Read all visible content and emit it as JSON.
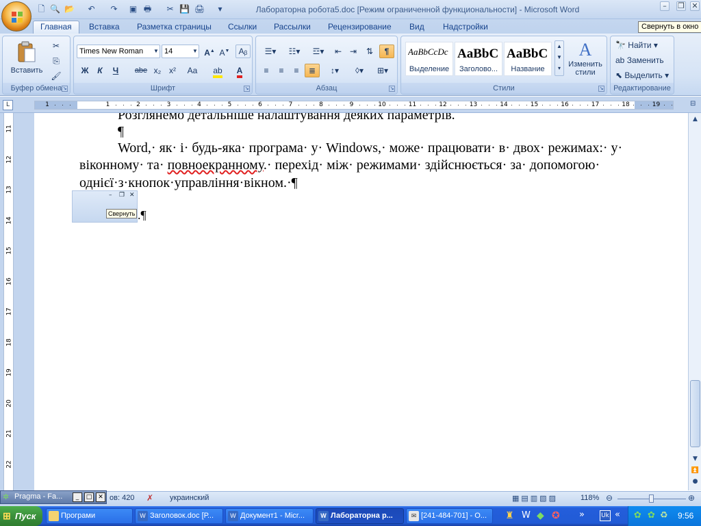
{
  "window": {
    "title": "Лабораторна робота5.doc [Режим ограниченной функциональности] - Microsoft Word",
    "tooltip": "Свернуть в окно"
  },
  "tabs": [
    "Главная",
    "Вставка",
    "Разметка страницы",
    "Ссылки",
    "Рассылки",
    "Рецензирование",
    "Вид",
    "Надстройки"
  ],
  "ribbon": {
    "clipboard": {
      "label": "Буфер обмена",
      "paste": "Вставить"
    },
    "font": {
      "label": "Шрифт",
      "name": "Times New Roman",
      "size": "14",
      "bold": "Ж",
      "italic": "К",
      "underline": "Ч",
      "strike": "abe",
      "sub": "x₂",
      "sup": "x²",
      "case": "Aa"
    },
    "paragraph": {
      "label": "Абзац"
    },
    "styles": {
      "label": "Стили",
      "items": [
        {
          "sample": "AaBbCcDc",
          "name": "Выделение"
        },
        {
          "sample": "AaBbC",
          "name": "Заголово..."
        },
        {
          "sample": "AaBbC",
          "name": "Название"
        }
      ],
      "change": "Изменить стили"
    },
    "editing": {
      "label": "Редактирование",
      "find": "Найти",
      "replace": "Заменить",
      "select": "Выделить"
    }
  },
  "ruler": {
    "h": [
      "1",
      "1",
      "2",
      "3",
      "4",
      "5",
      "6",
      "7",
      "8",
      "9",
      "10",
      "11",
      "12",
      "13",
      "14",
      "15",
      "16",
      "17",
      "18",
      "19"
    ],
    "v": [
      "11",
      "12",
      "13",
      "14",
      "15",
      "16",
      "17",
      "18",
      "19",
      "20",
      "21",
      "22"
    ]
  },
  "document": {
    "line_top": "Розглянемо детальніше налаштування деяких параметрів.",
    "empty_para": "¶",
    "para_main_1": "Word,· як· і· будь-яка· програма· у· Windows,· може· працювати· в· двох· режимах:· у·",
    "para_main_2a": "віконному· та·",
    "para_main_2b": "повноекранному",
    "para_main_2c": ".· перехід· між· режимами· здійснюється· за· допомогою·",
    "para_main_3": "однієї·з·кнопок·управління·вікном.·¶",
    "inline_tooltip": "Свернуть",
    "after_image": ".¶"
  },
  "statusbar": {
    "words": "ов: 420",
    "language": "украинский",
    "zoom": "118%"
  },
  "pragma": {
    "label": "Pragma - Fa..."
  },
  "taskbar": {
    "start": "Пуск",
    "tasks": [
      "Програми",
      "Заголовок.doc [Р...",
      "Документ1 - Micr...",
      "Лабораторна р...",
      "[241-484-701] - О..."
    ],
    "lang": "Uk",
    "clock": "9:56"
  },
  "colors": {
    "ribbon": "#d5e3f5",
    "taskbar": "#245edb",
    "start": "#3b8f3b"
  }
}
